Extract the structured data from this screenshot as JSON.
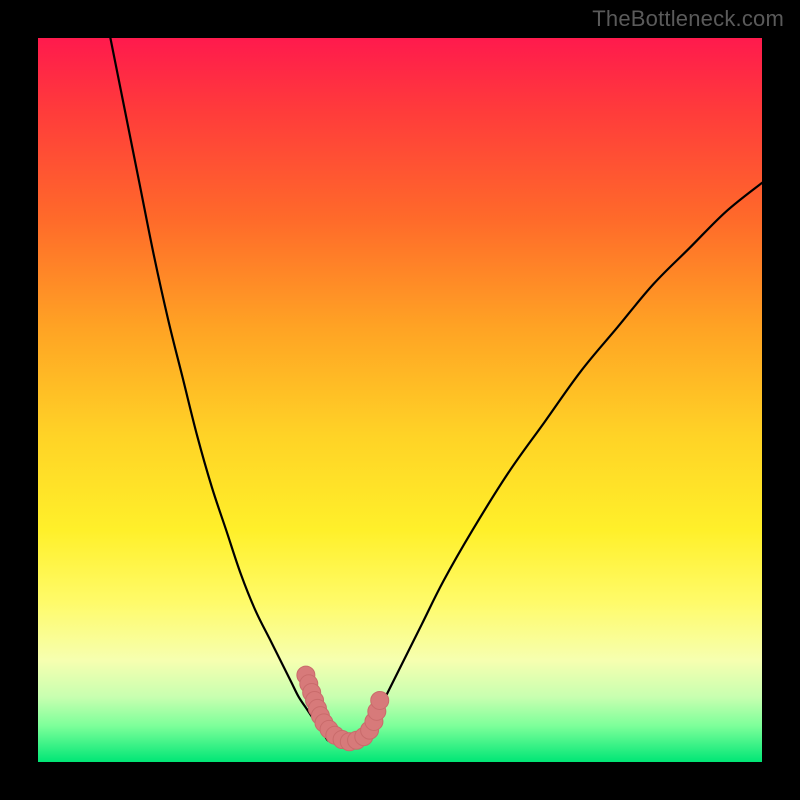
{
  "watermark": "TheBottleneck.com",
  "colors": {
    "frame": "#000000",
    "curve_stroke": "#000000",
    "marker_fill": "#d77a7a",
    "marker_stroke": "#c96b6b"
  },
  "chart_data": {
    "type": "line",
    "title": "",
    "xlabel": "",
    "ylabel": "",
    "xlim": [
      0,
      100
    ],
    "ylim": [
      0,
      100
    ],
    "axis_orientation": "y increases downward (0 at top, 100 at bottom)",
    "note": "No numeric axis ticks are visible; x and y are normalized 0–100 percentages of the plot area. Values estimated from curve geometry.",
    "series": [
      {
        "name": "left-curve",
        "color": "#000000",
        "x": [
          10,
          12,
          14,
          16,
          18,
          20,
          22,
          24,
          26,
          28,
          30,
          32,
          33,
          34,
          35,
          36,
          37,
          38,
          39,
          40
        ],
        "y": [
          0,
          10,
          20,
          30,
          39,
          47,
          55,
          62,
          68,
          74,
          79,
          83,
          85,
          87,
          89,
          91,
          92.5,
          94,
          95.5,
          97
        ]
      },
      {
        "name": "right-curve",
        "color": "#000000",
        "x": [
          45,
          46,
          47,
          48,
          50,
          53,
          56,
          60,
          65,
          70,
          75,
          80,
          85,
          90,
          95,
          100
        ],
        "y": [
          97,
          95,
          93,
          91,
          87,
          81,
          75,
          68,
          60,
          53,
          46,
          40,
          34,
          29,
          24,
          20
        ]
      },
      {
        "name": "bottom-connector-markers",
        "color": "#d77a7a",
        "type": "scatter",
        "x": [
          37.0,
          37.4,
          37.8,
          38.2,
          38.6,
          39.0,
          39.5,
          40.2,
          41.0,
          42.0,
          43.0,
          44.0,
          45.0,
          45.8,
          46.4,
          46.8,
          47.2
        ],
        "y": [
          88.0,
          89.2,
          90.4,
          91.5,
          92.6,
          93.6,
          94.6,
          95.5,
          96.3,
          96.9,
          97.2,
          97.0,
          96.5,
          95.6,
          94.4,
          93.0,
          91.5
        ]
      }
    ]
  }
}
